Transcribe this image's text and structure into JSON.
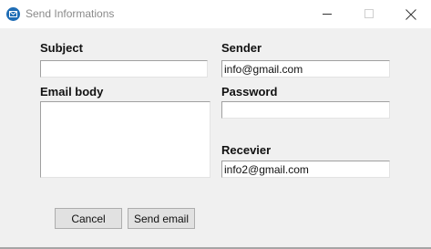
{
  "window": {
    "title": "Send Informations",
    "icon": "mail-icon",
    "controls": [
      "minimize-icon",
      "maximize-icon",
      "close-icon"
    ]
  },
  "form": {
    "subject_label": "Subject",
    "subject_value": "",
    "sender_label": "Sender",
    "sender_value": "info@gmail.com",
    "email_body_label": "Email body",
    "email_body_value": "",
    "password_label": "Password",
    "password_value": "",
    "receiver_label": "Recevier",
    "receiver_value": "info2@gmail.com"
  },
  "buttons": {
    "cancel_label": "Cancel",
    "send_label": "Send email"
  }
}
